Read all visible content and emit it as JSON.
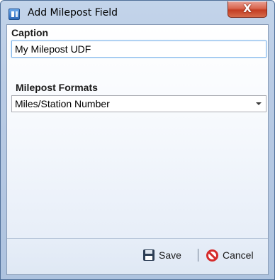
{
  "window": {
    "title": "Add Milepost Field",
    "close_glyph": "X"
  },
  "caption": {
    "label": "Caption",
    "value": "My Milepost UDF"
  },
  "milepost_formats": {
    "label": "Milepost Formats",
    "selected": "Miles/Station Number"
  },
  "footer": {
    "save_label": "Save",
    "cancel_label": "Cancel"
  },
  "icons": {
    "app": "app-icon",
    "save": "floppy-disk-icon",
    "cancel": "no-entry-icon",
    "dropdown": "chevron-down-icon"
  },
  "colors": {
    "close_button": "#c33d23",
    "cancel_icon": "#d52b2b",
    "input_focus_border": "#7eb4ea"
  }
}
